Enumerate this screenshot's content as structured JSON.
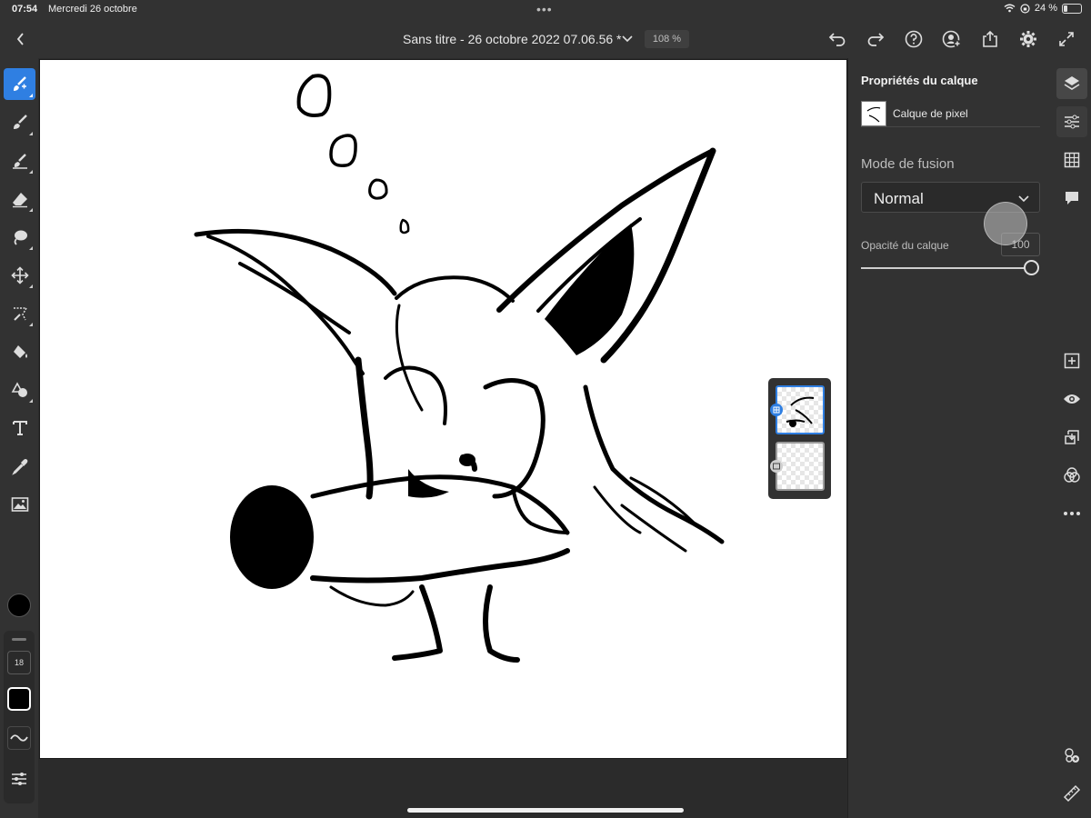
{
  "status_bar": {
    "time": "07:54",
    "date": "Mercredi 26 octobre",
    "battery": "24 %",
    "battery_level": 0.24
  },
  "header": {
    "document_title": "Sans titre - 26 octobre 2022 07.06.56 *",
    "zoom": "108 %"
  },
  "toolbar": {
    "tools": [
      {
        "name": "paint-brush-tool",
        "icon": "brush-active-icon"
      },
      {
        "name": "brush-tool",
        "icon": "brush-icon"
      },
      {
        "name": "smudge-tool",
        "icon": "smudge-icon"
      },
      {
        "name": "eraser-tool",
        "icon": "eraser-icon"
      },
      {
        "name": "lasso-tool",
        "icon": "lasso-icon"
      },
      {
        "name": "move-tool",
        "icon": "move-icon"
      },
      {
        "name": "selection-tool",
        "icon": "magic-wand-icon"
      },
      {
        "name": "fill-tool",
        "icon": "paint-bucket-icon"
      },
      {
        "name": "shape-tool",
        "icon": "shapes-icon"
      },
      {
        "name": "text-tool",
        "icon": "text-icon"
      },
      {
        "name": "eyedropper-tool",
        "icon": "eyedropper-icon"
      },
      {
        "name": "place-image-tool",
        "icon": "image-icon"
      }
    ],
    "current_color": "#000000",
    "brush_size": "18"
  },
  "properties": {
    "title": "Propriétés du calque",
    "layer_name": "Calque de pixel",
    "blend_label": "Mode de fusion",
    "blend_mode": "Normal",
    "opacity_label": "Opacité du calque",
    "opacity_value": "100"
  },
  "colors": {
    "accent": "#2f7fe2",
    "panel": "#323232",
    "canvas": "#ffffff"
  }
}
